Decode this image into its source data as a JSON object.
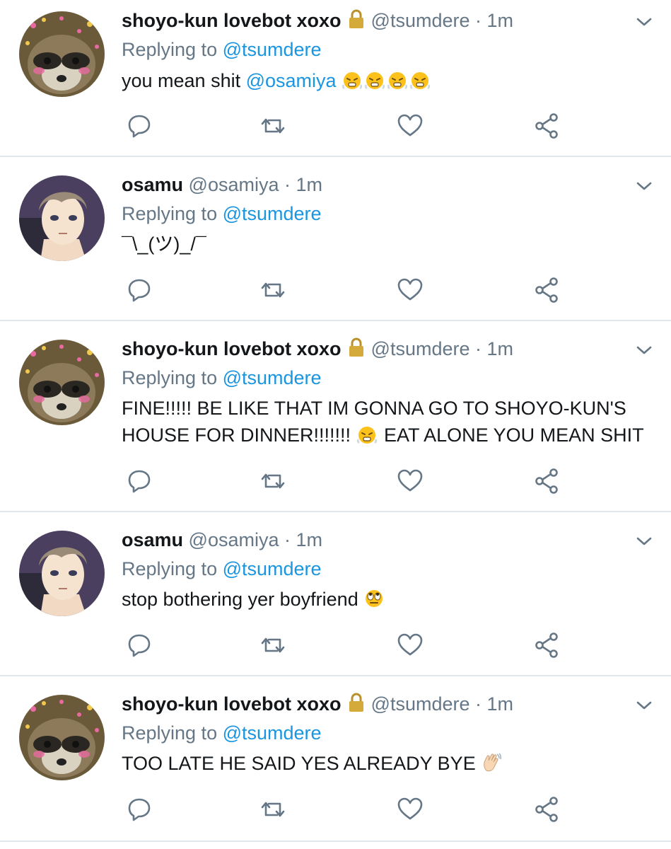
{
  "tweets": [
    {
      "avatar": "raccoon",
      "name": "shoyo-kun lovebot xoxo",
      "locked": true,
      "handle": "@tsumdere",
      "separator": "·",
      "time": "1m",
      "replying_prefix": "Replying to",
      "replying_to": "@tsumdere",
      "text_parts": [
        {
          "t": "you mean shit ",
          "kind": "text"
        },
        {
          "t": "@osamiya",
          "kind": "mention"
        },
        {
          "t": " ",
          "kind": "text"
        }
      ],
      "emojis": [
        "face-with-steam-emoji",
        "face-with-steam-emoji",
        "face-with-steam-emoji",
        "face-with-steam-emoji"
      ],
      "emoji_after": true
    },
    {
      "avatar": "osamu",
      "name": "osamu",
      "locked": false,
      "handle": "@osamiya",
      "separator": "·",
      "time": "1m",
      "replying_prefix": "Replying to",
      "replying_to": "@tsumdere",
      "text_parts": [
        {
          "t": "¯\\_(ツ)_/¯",
          "kind": "text"
        }
      ],
      "emojis": []
    },
    {
      "avatar": "raccoon",
      "name": "shoyo-kun lovebot xoxo",
      "locked": true,
      "handle": "@tsumdere",
      "separator": "·",
      "time": "1m",
      "replying_prefix": "Replying to",
      "replying_to": "@tsumdere",
      "text_line1": "FINE!!!!! BE LIKE THAT IM GONNA GO TO SHOYO-KUN'S",
      "text_line2a": "HOUSE FOR DINNER!!!!!!! ",
      "text_line2b": " EAT ALONE YOU MEAN SHIT",
      "emojis": [
        "face-with-steam-emoji"
      ]
    },
    {
      "avatar": "osamu",
      "name": "osamu",
      "locked": false,
      "handle": "@osamiya",
      "separator": "·",
      "time": "1m",
      "replying_prefix": "Replying to",
      "replying_to": "@tsumdere",
      "text_parts": [
        {
          "t": "stop bothering yer boyfriend ",
          "kind": "text"
        }
      ],
      "emojis": [
        "eye-roll-emoji"
      ]
    },
    {
      "avatar": "raccoon",
      "name": "shoyo-kun lovebot xoxo",
      "locked": true,
      "handle": "@tsumdere",
      "separator": "·",
      "time": "1m",
      "replying_prefix": "Replying to",
      "replying_to": "@tsumdere",
      "text_parts": [
        {
          "t": "TOO LATE HE SAID YES ALREADY BYE ",
          "kind": "text"
        }
      ],
      "emojis": [
        "waving-hand-emoji"
      ]
    }
  ],
  "icons": {
    "reply": "reply-icon",
    "retweet": "retweet-icon",
    "like": "like-icon",
    "share": "share-icon",
    "menu": "chevron-down-icon",
    "lock": "lock-icon"
  },
  "colors": {
    "name": "#14171a",
    "secondary": "#657786",
    "mention": "#1b95e0",
    "divider": "#e1e8ed",
    "lock": "#c9a227"
  }
}
